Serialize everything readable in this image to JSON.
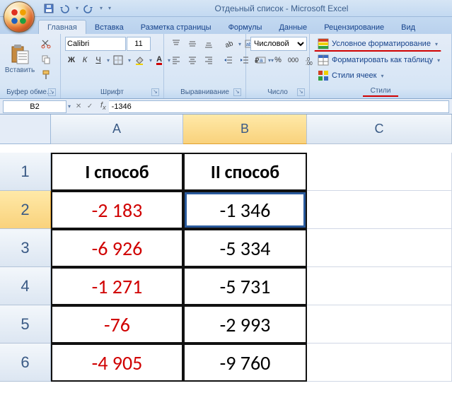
{
  "title": "Отдеьный список - Microsoft Excel",
  "tabs": {
    "home": "Главная",
    "insert": "Вставка",
    "layout": "Разметка страницы",
    "formulas": "Формулы",
    "data": "Данные",
    "review": "Рецензирование",
    "view": "Вид"
  },
  "groups": {
    "clipboard": "Буфер обме…",
    "font": "Шрифт",
    "alignment": "Выравнивание",
    "number": "Число",
    "styles": "Стили"
  },
  "clipboard": {
    "paste": "Вставить"
  },
  "font": {
    "name": "Calibri",
    "size": "11",
    "bold": "Ж",
    "italic": "К",
    "underline": "Ч"
  },
  "number": {
    "format": "Числовой"
  },
  "styles": {
    "conditional": "Условное форматирование",
    "table": "Форматировать как таблицу",
    "cell": "Стили ячеек"
  },
  "namebox": "B2",
  "formula": "-1346",
  "columns": [
    "A",
    "B",
    "C"
  ],
  "sheet": {
    "A1": "I способ",
    "B1": "II способ",
    "A2": "-2 183",
    "B2": "-1 346",
    "A3": "-6 926",
    "B3": "-5 334",
    "A4": "-1 271",
    "B4": "-5 731",
    "A5": "-76",
    "B5": "-2 993",
    "A6": "-4 905",
    "B6": "-9 760"
  },
  "chart_data": {
    "type": "table",
    "title": "",
    "columns": [
      "I способ",
      "II способ"
    ],
    "rows": [
      [
        -2183,
        -1346
      ],
      [
        -6926,
        -5334
      ],
      [
        -1271,
        -5731
      ],
      [
        -76,
        -2993
      ],
      [
        -4905,
        -9760
      ]
    ]
  }
}
